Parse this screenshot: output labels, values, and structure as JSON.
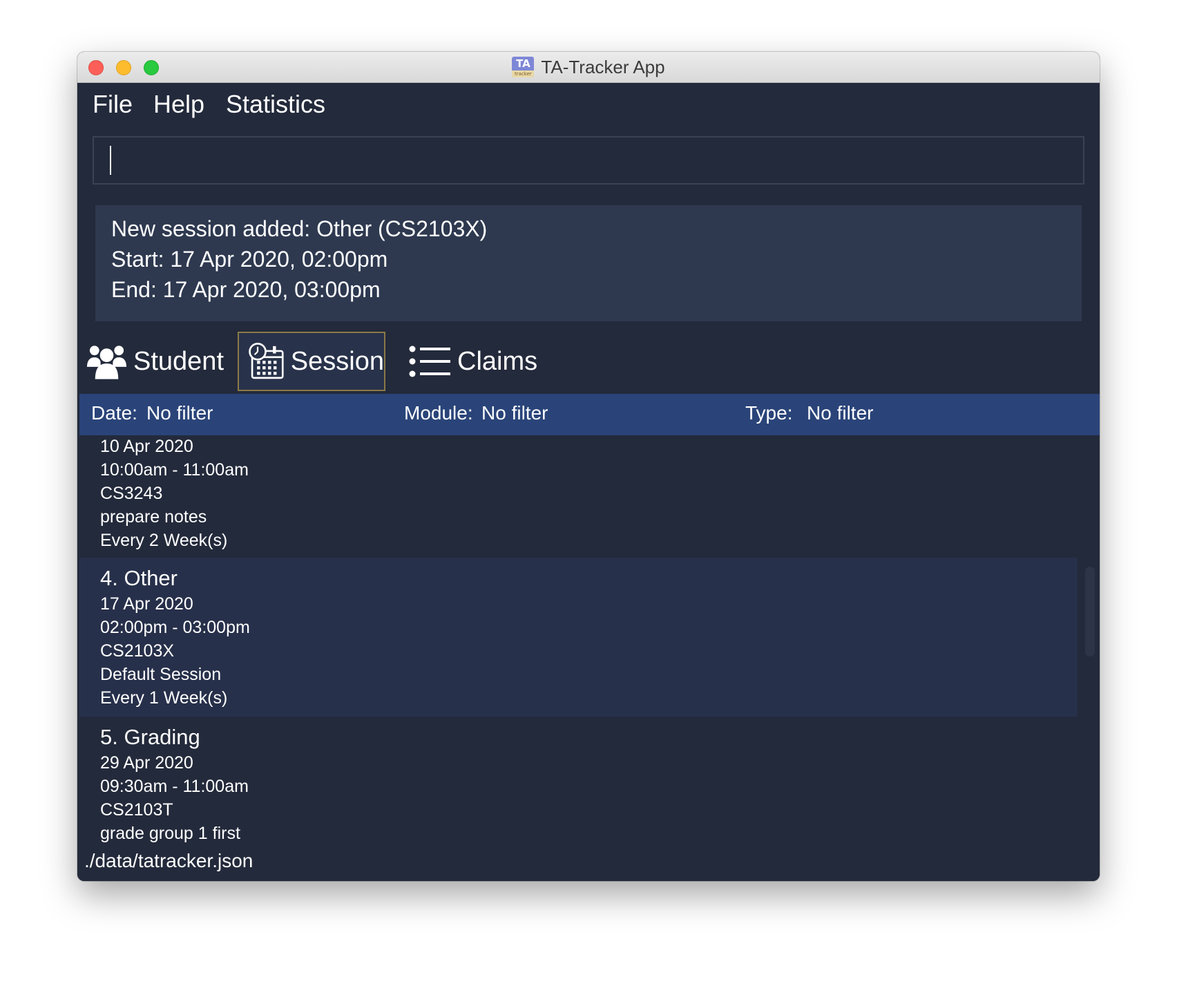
{
  "window": {
    "title": "TA-Tracker App",
    "icon_text": "TA",
    "icon_subtext": "tracker"
  },
  "menu": {
    "items": [
      "File",
      "Help",
      "Statistics"
    ]
  },
  "command": {
    "value": "",
    "placeholder": ""
  },
  "result": {
    "lines": [
      "New session added: Other (CS2103X)",
      "Start: 17 Apr 2020, 02:00pm",
      "End: 17 Apr 2020, 03:00pm"
    ]
  },
  "tabs": {
    "student": "Student",
    "session": "Session",
    "claims": "Claims",
    "active": "session"
  },
  "filters": {
    "date_label": "Date:",
    "date_value": "No filter",
    "module_label": "Module:",
    "module_value": "No filter",
    "type_label": "Type:",
    "type_value": "No filter"
  },
  "sessions": [
    {
      "date": "10 Apr 2020",
      "time": "10:00am - 11:00am",
      "module": "CS3243",
      "description": "prepare notes",
      "recurrence": "Every 2 Week(s)"
    },
    {
      "header": "4.  Other",
      "date": "17 Apr 2020",
      "time": "02:00pm - 03:00pm",
      "module": "CS2103X",
      "description": "Default Session",
      "recurrence": "Every 1 Week(s)"
    },
    {
      "header": "5.  Grading",
      "date": "29 Apr 2020",
      "time": "09:30am - 11:00am",
      "module": "CS2103T",
      "description": "grade group 1 first"
    }
  ],
  "status": {
    "path": "./data/tatracker.json"
  },
  "colors": {
    "background": "#232a3b",
    "result_panel": "#2e3950",
    "filter_bar": "#2a4479",
    "card_alt": "#27304a",
    "active_tab_border": "#8a7a47"
  },
  "icons": {
    "student": "users-icon",
    "session": "calendar-clock-icon",
    "claims": "list-icon"
  }
}
